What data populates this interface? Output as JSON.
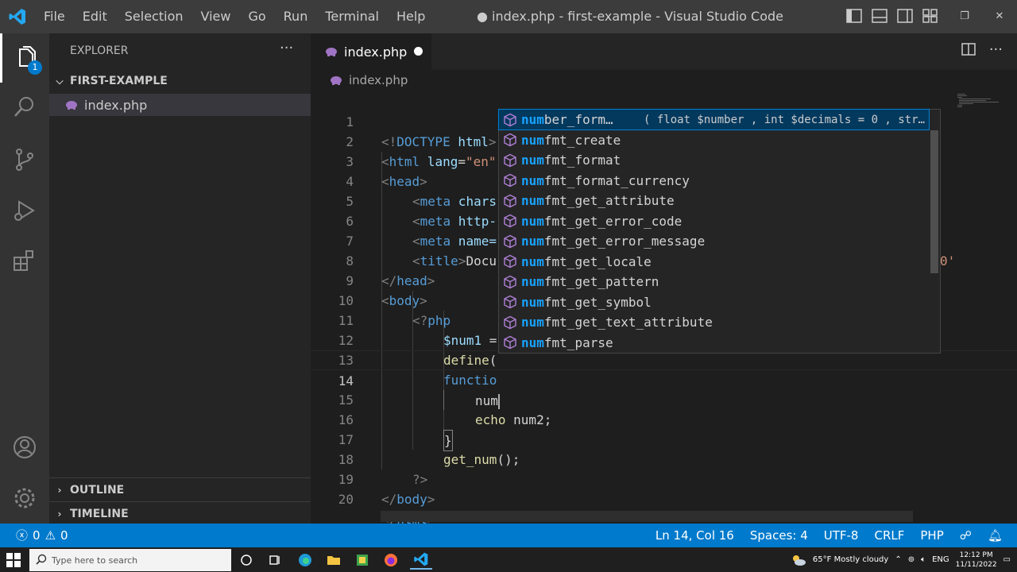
{
  "window": {
    "title": "● index.php - first-example - Visual Studio Code",
    "menu": [
      "File",
      "Edit",
      "Selection",
      "View",
      "Go",
      "Run",
      "Terminal",
      "Help"
    ],
    "controls": [
      "—",
      "❐",
      "✕"
    ]
  },
  "activity": {
    "explorer_badge": "1"
  },
  "sidebar": {
    "header": "EXPLORER",
    "more": "···",
    "folder": "FIRST-EXAMPLE",
    "file": "index.php",
    "outline": "OUTLINE",
    "timeline": "TIMELINE"
  },
  "editor": {
    "tab_label": "index.php",
    "breadcrumb": "index.php",
    "lines": [
      {
        "n": "1"
      },
      {
        "n": "2"
      },
      {
        "n": "3"
      },
      {
        "n": "4"
      },
      {
        "n": "5"
      },
      {
        "n": "6"
      },
      {
        "n": "7"
      },
      {
        "n": "8"
      },
      {
        "n": "9"
      },
      {
        "n": "10"
      },
      {
        "n": "11"
      },
      {
        "n": "12"
      },
      {
        "n": "13"
      },
      {
        "n": "14"
      },
      {
        "n": "15"
      },
      {
        "n": "16"
      },
      {
        "n": "17"
      },
      {
        "n": "18"
      },
      {
        "n": "19"
      },
      {
        "n": "20"
      }
    ],
    "code": {
      "l1_a": "<!",
      "l1_b": "DOCTYPE",
      "l1_c": " html",
      "l1_d": ">",
      "l2_a": "<",
      "l2_b": "html",
      "l2_c": " lang",
      "l2_d": "=",
      "l2_e": "\"en\"",
      "l3_a": "<",
      "l3_b": "head",
      "l3_c": ">",
      "l4_a": "<",
      "l4_b": "meta",
      "l4_c": " chars",
      "l5_a": "<",
      "l5_b": "meta",
      "l5_c": " http-",
      "l6_a": "<",
      "l6_b": "meta",
      "l6_c": " name=",
      "l6_tail": "0'",
      "l7_a": "<",
      "l7_b": "title",
      "l7_c": ">",
      "l7_d": "Docu",
      "l8_a": "</",
      "l8_b": "head",
      "l8_c": ">",
      "l9_a": "<",
      "l9_b": "body",
      "l9_c": ">",
      "l10_a": "<?",
      "l10_b": "php",
      "l11_a": "$num1",
      "l11_b": " =",
      "l12_a": "define",
      "l12_b": "(",
      "l13_a": "functio",
      "l14_a": "num",
      "l15_a": "echo",
      "l15_b": " num2;",
      "l16_a": "}",
      "l17_a": "get_num",
      "l17_b": "();",
      "l18_a": "?>",
      "l19_a": "</",
      "l19_b": "body",
      "l19_c": ">",
      "l20_a": "</",
      "l20_b": "html",
      "l20_c": ">"
    }
  },
  "suggest": {
    "match": "num",
    "selected_detail": "( float $number , int $decimals = 0 , str…",
    "items": [
      {
        "rest": "ber_form…"
      },
      {
        "rest": "fmt_create"
      },
      {
        "rest": "fmt_format"
      },
      {
        "rest": "fmt_format_currency"
      },
      {
        "rest": "fmt_get_attribute"
      },
      {
        "rest": "fmt_get_error_code"
      },
      {
        "rest": "fmt_get_error_message"
      },
      {
        "rest": "fmt_get_locale"
      },
      {
        "rest": "fmt_get_pattern"
      },
      {
        "rest": "fmt_get_symbol"
      },
      {
        "rest": "fmt_get_text_attribute"
      },
      {
        "rest": "fmt_parse"
      }
    ]
  },
  "statusbar": {
    "errors": "0",
    "warnings": "0",
    "position": "Ln 14, Col 16",
    "spaces": "Spaces: 4",
    "encoding": "UTF-8",
    "eol": "CRLF",
    "language": "PHP"
  },
  "taskbar": {
    "search_placeholder": "Type here to search",
    "weather": "65°F  Mostly cloudy",
    "lang": "ENG",
    "time": "12:12 PM",
    "date": "11/11/2022"
  },
  "colors": {
    "accent": "#007acc",
    "match": "#18a3ff",
    "selected_row": "#04395e"
  }
}
